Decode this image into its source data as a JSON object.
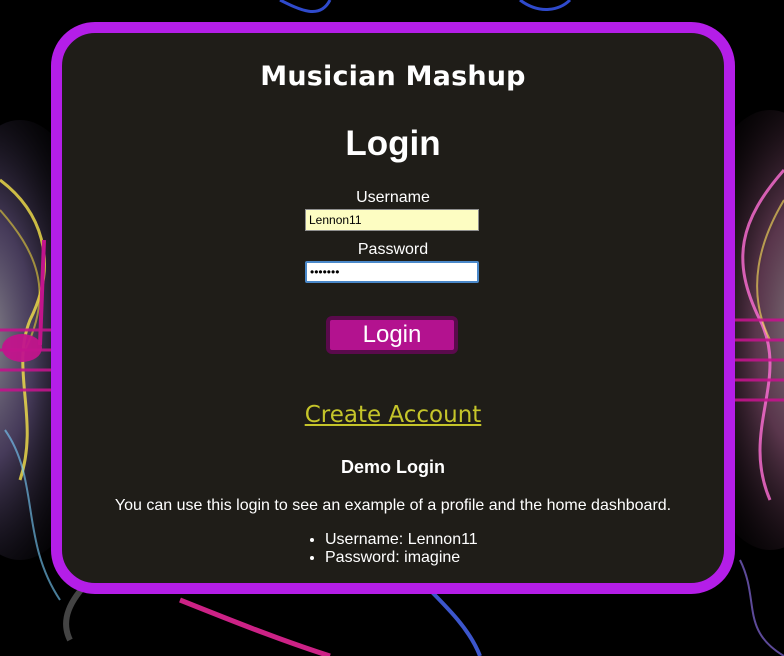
{
  "header": {
    "site_title": "Musician Mashup"
  },
  "login_form": {
    "heading": "Login",
    "username_label": "Username",
    "username_value": "Lennon11",
    "password_label": "Password",
    "password_masked": "•••••••",
    "submit_label": "Login"
  },
  "links": {
    "create_account": "Create Account"
  },
  "demo": {
    "heading": "Demo Login",
    "description": "You can use this login to see an example of a profile and the home dashboard.",
    "credentials": [
      "Username: Lennon11",
      "Password: imagine"
    ]
  },
  "colors": {
    "card_border": "#b41ee8",
    "card_background": "#1f1d18",
    "button": "#b3128f",
    "link": "#c5c52a"
  }
}
